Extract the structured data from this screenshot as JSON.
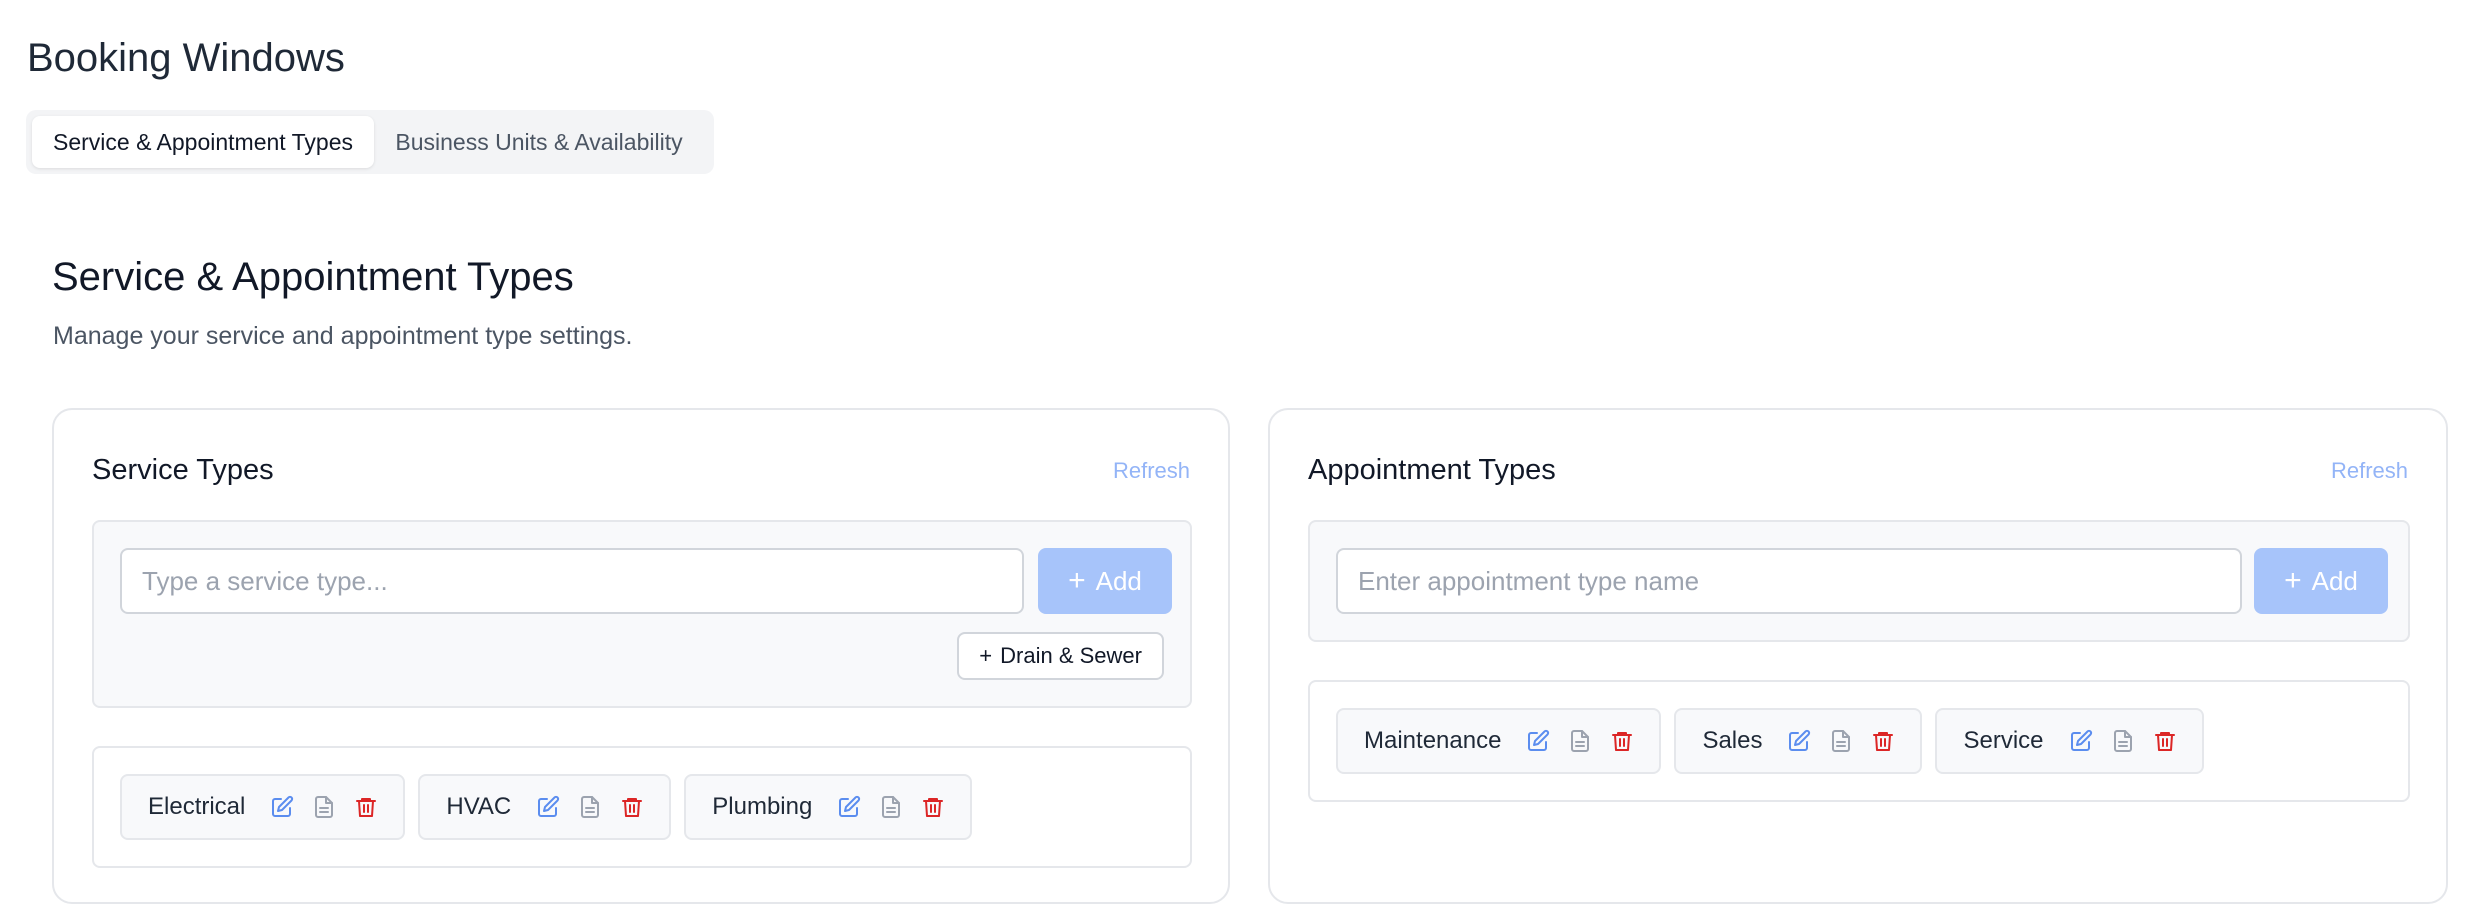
{
  "page": {
    "title": "Booking Windows"
  },
  "tabs": [
    {
      "label": "Service & Appointment Types",
      "active": true
    },
    {
      "label": "Business Units & Availability",
      "active": false
    }
  ],
  "section": {
    "title": "Service & Appointment Types",
    "subtitle": "Manage your service and appointment type settings."
  },
  "service_types": {
    "title": "Service Types",
    "refresh_label": "Refresh",
    "input_placeholder": "Type a service type...",
    "input_value": "",
    "add_label": "Add",
    "suggestion_label": "Drain & Sewer",
    "items": [
      "Electrical",
      "HVAC",
      "Plumbing"
    ]
  },
  "appointment_types": {
    "title": "Appointment Types",
    "refresh_label": "Refresh",
    "input_placeholder": "Enter appointment type name",
    "input_value": "",
    "add_label": "Add",
    "items": [
      "Maintenance",
      "Sales",
      "Service"
    ]
  },
  "icons": {
    "edit": "edit-icon",
    "details": "document-icon",
    "delete": "trash-icon",
    "add": "plus-icon"
  },
  "colors": {
    "accent": "#5b8def",
    "add_button": "#a7c4fa",
    "delete": "#dc2626",
    "refresh": "#93b4f7",
    "icon_gray": "#9ca3af"
  }
}
